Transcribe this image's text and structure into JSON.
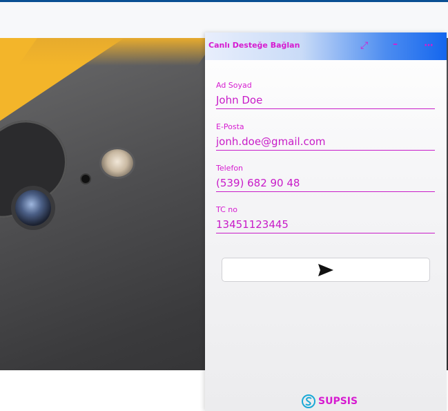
{
  "widget": {
    "title": "Canlı Desteğe Bağlan",
    "icons": {
      "expand": "expand-icon",
      "minimize": "minimize-icon",
      "menu": "menu-icon"
    },
    "fields": [
      {
        "label": "Ad Soyad",
        "value": "John Doe"
      },
      {
        "label": "E-Posta",
        "value": "jonh.doe@gmail.com"
      },
      {
        "label": "Telefon",
        "value": "(539) 682 90 48"
      },
      {
        "label": "TC no",
        "value": "13451123445"
      }
    ],
    "send_icon": "send-icon",
    "brand": "SUPSIS"
  },
  "colors": {
    "accent": "#d61bd0",
    "header_blue": "#1466ee",
    "topbar": "#0a4f93"
  }
}
